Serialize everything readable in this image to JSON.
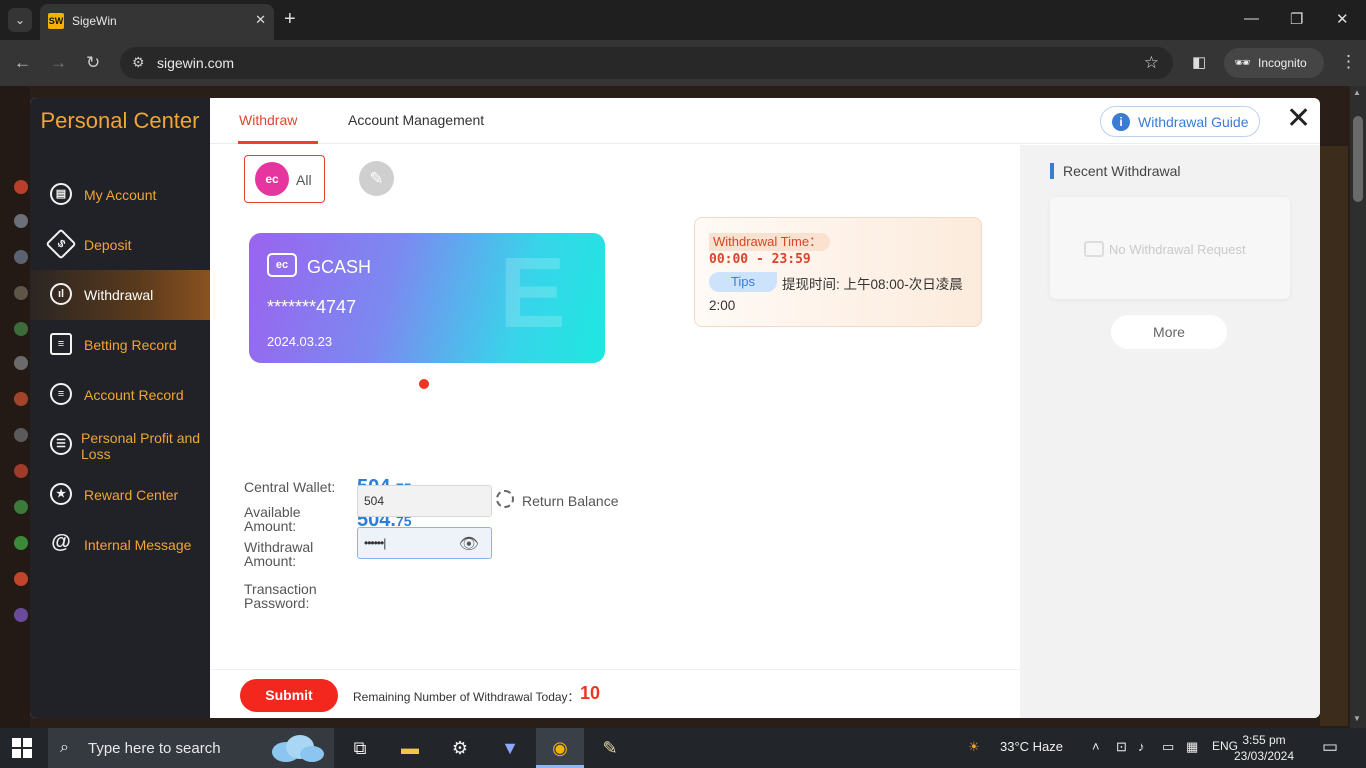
{
  "browser": {
    "tab_title": "SigeWin",
    "tab_favicon": "SW",
    "url": "sigewin.com",
    "incognito_label": "Incognito",
    "new_tab": "+",
    "tab_close": "✕",
    "window_controls": {
      "minimize": "—",
      "restore": "❐",
      "close": "✕"
    },
    "nav": {
      "back": "←",
      "forward": "→",
      "reload": "↻"
    }
  },
  "sidebar": {
    "title": "Personal Center",
    "items": [
      {
        "label": "My Account",
        "icon": "account-icon"
      },
      {
        "label": "Deposit",
        "icon": "deposit-icon"
      },
      {
        "label": "Withdrawal",
        "icon": "withdrawal-icon",
        "active": true
      },
      {
        "label": "Betting Record",
        "icon": "betting-record-icon"
      },
      {
        "label": "Account Record",
        "icon": "account-record-icon"
      },
      {
        "label": "Personal Profit and Loss",
        "icon": "profit-loss-icon"
      },
      {
        "label": "Reward Center",
        "icon": "reward-icon"
      },
      {
        "label": "Internal Message",
        "icon": "message-icon"
      }
    ]
  },
  "tabs": {
    "withdraw": "Withdraw",
    "account_management": "Account Management"
  },
  "guide_label": "Withdrawal Guide",
  "method": {
    "label": "All",
    "icon_text": "ec"
  },
  "card": {
    "name": "GCASH",
    "number": "*******4747",
    "date": "2024.03.23",
    "icon_text": "ec"
  },
  "withdrawal_time": {
    "title": "Withdrawal Time：",
    "time": "00:00  - 23:59",
    "tips_label": "Tips",
    "note": "提现时间: 上午08:00-次日凌晨2:00"
  },
  "form": {
    "central_wallet_label": "Central Wallet:",
    "central_wallet_int": "504.",
    "central_wallet_dec": "75",
    "available_label_1": "Available",
    "available_label_2": "Amount:",
    "available_int": "504.",
    "available_dec": "75",
    "withdrawal_label_1": "Withdrawal",
    "withdrawal_label_2": "Amount:",
    "withdrawal_value": "504",
    "return_balance": "Return Balance",
    "password_label_1": "Transaction",
    "password_label_2": "Password:",
    "password_value": "••••••|"
  },
  "footer": {
    "submit": "Submit",
    "remaining_label": "Remaining Number of Withdrawal Today：",
    "remaining_value": "10"
  },
  "recent": {
    "title": "Recent Withdrawal",
    "empty": "No Withdrawal Request",
    "more": "More"
  },
  "taskbar": {
    "search_placeholder": "Type here to search",
    "weather": "33°C  Haze",
    "language": "ENG",
    "time": "3:55 pm",
    "date": "23/03/2024"
  }
}
